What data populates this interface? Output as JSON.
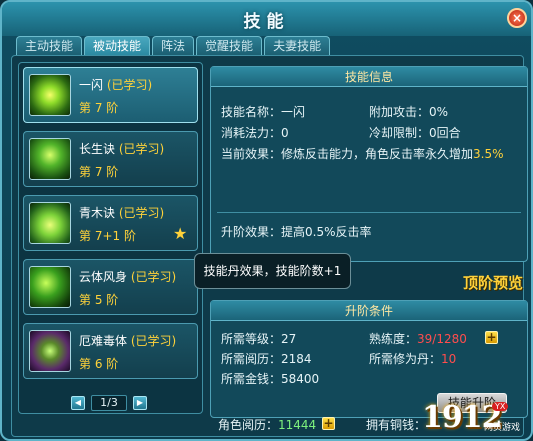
{
  "window": {
    "title": "技能",
    "close_label": "×"
  },
  "tabs": [
    {
      "label": "主动技能",
      "active": false
    },
    {
      "label": "被动技能",
      "active": true
    },
    {
      "label": "阵法",
      "active": false
    },
    {
      "label": "觉醒技能",
      "active": false
    },
    {
      "label": "夫妻技能",
      "active": false
    }
  ],
  "skills": [
    {
      "name": "一闪",
      "status": "(已学习)",
      "level": "第 7 阶",
      "icon": "flash-skill-icon",
      "selected": true
    },
    {
      "name": "长生诀",
      "status": "(已学习)",
      "level": "第 7 阶",
      "icon": "longevity-skill-icon"
    },
    {
      "name": "青木诀",
      "status": "(已学习)",
      "level": "第 7+1 阶",
      "icon": "wood-skill-icon"
    },
    {
      "name": "云体风身",
      "status": "(已学习)",
      "level": "第 5 阶",
      "icon": "wind-skill-icon"
    },
    {
      "name": "厄难毒体",
      "status": "(已学习)",
      "level": "第 6 阶",
      "icon": "poison-skill-icon"
    }
  ],
  "pager": {
    "text": "1/3"
  },
  "info": {
    "header": "技能信息",
    "name_label": "技能名称：",
    "name_value": "一闪",
    "attack_label": "附加攻击：",
    "attack_value": "0%",
    "mana_label": "消耗法力：",
    "mana_value": "0",
    "cooldown_label": "冷却限制：",
    "cooldown_value": "0回合",
    "effect_label": "当前效果：",
    "effect_text": "修炼反击能力，角色反击率永久增加",
    "effect_value": "3.5%",
    "upgrade_label": "升阶效果：",
    "upgrade_text": "提高0.5%反击率"
  },
  "tooltip": "技能丹效果，技能阶数+1",
  "preview_label": "顶阶预览",
  "conditions": {
    "header": "升阶条件",
    "level_label": "所需等级：",
    "level_value": "27",
    "proficiency_label": "熟练度：",
    "proficiency_value": "39/1280",
    "exp_label": "所需阅历：",
    "exp_value": "2184",
    "pill_label": "所需修为丹：",
    "pill_value": "10",
    "money_label": "所需金钱：",
    "money_value": "58400",
    "button": "技能升阶"
  },
  "footer": {
    "exp_label": "角色阅历：",
    "exp_value": "11444",
    "coins_label": "拥有铜钱："
  },
  "watermark": {
    "number": "1912",
    "badge": "YX",
    "subtitle": "网页游戏"
  }
}
